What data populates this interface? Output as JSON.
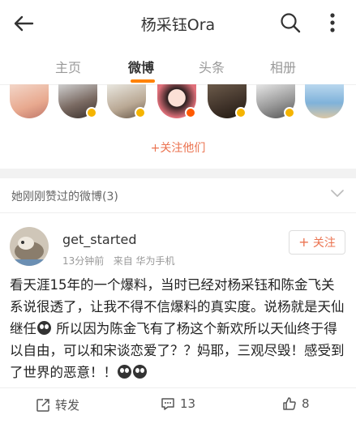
{
  "header": {
    "title": "杨采钰Ora"
  },
  "tabs": [
    {
      "label": "主页",
      "active": false
    },
    {
      "label": "微博",
      "active": true
    },
    {
      "label": "头条",
      "active": false
    },
    {
      "label": "相册",
      "active": false
    }
  ],
  "follow_them": "+关注他们",
  "liked_section": {
    "title": "她刚刚赞过的微博(3)"
  },
  "post": {
    "username": "get_started",
    "time": "13分钟前",
    "source": "来自 华为手机",
    "follow_label": "关注",
    "text_1": "看天涯15年的一个爆料，当时已经对杨采钰和陈金飞关系说很透了，让我不得不信爆料的真实度。说杨就是天仙继任",
    "text_2": " 所以因为陈金飞有了杨这个新欢所以天仙终于得以自由，可以和宋谈恋爱了？？妈耶，三观尽毁！感受到了世界的恶意！！",
    "repost_label": "转发",
    "comments": "13",
    "likes": "8"
  },
  "colors": {
    "accent": "#ff8200",
    "link": "#eb7350"
  },
  "icons": [
    "back-arrow-icon",
    "search-icon",
    "more-icon",
    "chevron-down-icon",
    "repost-icon",
    "comment-icon",
    "like-icon"
  ]
}
